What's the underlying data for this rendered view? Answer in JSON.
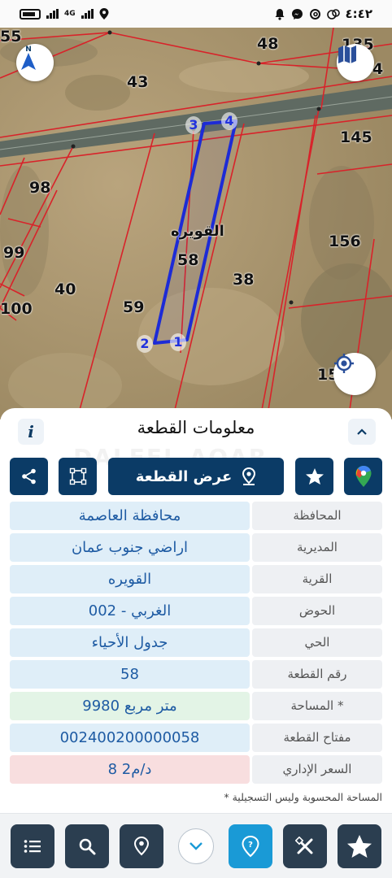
{
  "status_bar": {
    "time": "٤:٤٢",
    "network": "4G"
  },
  "map": {
    "plot_numbers": [
      "55",
      "48",
      "43",
      "135",
      "4",
      "145",
      "98",
      "156",
      "99",
      "58",
      "38",
      "40",
      "100",
      "59",
      "15"
    ],
    "village_label": "القويره",
    "corner_labels": [
      "1",
      "2",
      "3",
      "4"
    ],
    "compass_label": "N"
  },
  "panel": {
    "title": "معلومات القطعة",
    "watermark": "DALEEL AQAR",
    "show_plot_button": "عرض القطعة",
    "rows": [
      {
        "label": "المحافظة",
        "value": "محافظة العاصمة"
      },
      {
        "label": "المديرية",
        "value": "اراضي جنوب عمان"
      },
      {
        "label": "القرية",
        "value": "القويره"
      },
      {
        "label": "الحوض",
        "value": "الغربي - 002"
      },
      {
        "label": "الحي",
        "value": "جدول الأحياء"
      },
      {
        "label": "رقم القطعة",
        "value": "58"
      },
      {
        "label": "المساحة *",
        "value": "9980   متر مربع"
      },
      {
        "label": "مفتاح القطعة",
        "value": "002400200000058"
      },
      {
        "label": "السعر الإداري",
        "value": "8 د/م2"
      }
    ],
    "footnote": "* المساحة المحسوبة وليس التسجيلية"
  },
  "colors": {
    "navy": "#0b3b66",
    "toolbar_dark": "#2b3e50",
    "toolbar_active": "#1a9ad6",
    "plot_outline": "#1d2bd6",
    "parcel_lines": "#d8232a"
  }
}
